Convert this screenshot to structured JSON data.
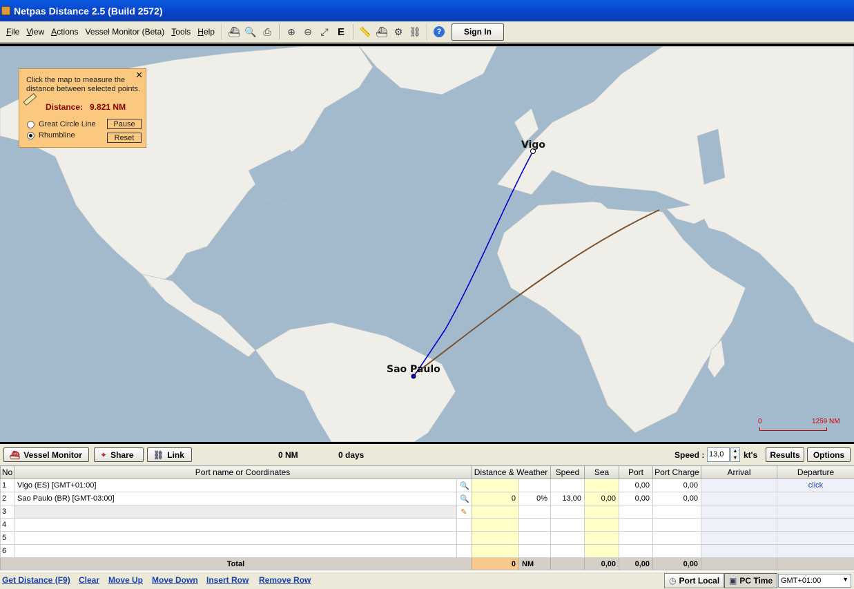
{
  "window": {
    "title": "Netpas Distance 2.5 (Build 2572)"
  },
  "menu": [
    {
      "first": "F",
      "rest": "ile"
    },
    {
      "first": "V",
      "rest": "iew"
    },
    {
      "first": "A",
      "rest": "ctions"
    },
    {
      "first": "",
      "rest": "Vessel Monitor (Beta)"
    },
    {
      "first": "T",
      "rest": "ools"
    },
    {
      "first": "H",
      "rest": "elp"
    }
  ],
  "toolbar": {
    "icons": [
      "ship-list-icon",
      "print-preview-icon",
      "print-icon",
      "zoom-in-icon",
      "zoom-out-icon",
      "fit-extent-icon",
      "eca-icon",
      "ruler-icon",
      "vessel-icon",
      "route-tools-icon",
      "link-chain-icon",
      "help-icon"
    ],
    "eca_glyph": "E",
    "sign_in_label": "Sign In"
  },
  "measure_panel": {
    "instructions": "Click the map to measure the distance between selected points.",
    "distance_label": "Distance:",
    "distance_value": "9.821 NM",
    "great_circle_label": "Great Circle Line",
    "rhumbline_label": "Rhumbline",
    "selected_mode": "rhumbline",
    "pause_label": "Pause",
    "reset_label": "Reset",
    "close_glyph": "✕"
  },
  "map": {
    "ports": [
      {
        "name": "Vigo"
      },
      {
        "name": "Sao Paulo"
      }
    ],
    "scale": {
      "start": "0",
      "end": "1259 NM"
    },
    "colors": {
      "sea": "#a3bacd",
      "land": "#efeee9",
      "route": "#0000cc",
      "measure_line": "#7a5230",
      "scale": "#cc0000"
    }
  },
  "actions": {
    "vessel_monitor_label": "Vessel Monitor",
    "share_label": "Share",
    "link_label": "Link",
    "total_distance": "0 NM",
    "total_days": "0 days",
    "speed_label": "Speed :",
    "speed_value": "13,0",
    "speed_unit": "kt's",
    "results_label": "Results",
    "options_label": "Options"
  },
  "grid": {
    "columns": [
      "No",
      "Port name or Coordinates",
      "Distance & Weather",
      "Speed",
      "Sea",
      "Port",
      "Port Charge",
      "Arrival",
      "Departure"
    ],
    "rows": [
      {
        "no": "1",
        "name": "Vigo (ES) [GMT+01:00]",
        "icon": "search-icon",
        "dist": "",
        "weather": "",
        "speed": "",
        "sea": "",
        "port": "0,00",
        "charge": "0,00",
        "arrival": "",
        "departure": "click"
      },
      {
        "no": "2",
        "name": "Sao Paulo (BR) [GMT-03:00]",
        "icon": "search-icon",
        "dist": "0",
        "weather": "0%",
        "speed": "13,00",
        "sea": "0,00",
        "port": "0,00",
        "charge": "0,00",
        "arrival": "",
        "departure": ""
      },
      {
        "no": "3",
        "name": "",
        "icon": "pencil-icon",
        "dist": "",
        "weather": "",
        "speed": "",
        "sea": "",
        "port": "",
        "charge": "",
        "arrival": "",
        "departure": ""
      },
      {
        "no": "4",
        "name": "",
        "icon": "",
        "dist": "",
        "weather": "",
        "speed": "",
        "sea": "",
        "port": "",
        "charge": "",
        "arrival": "",
        "departure": ""
      },
      {
        "no": "5",
        "name": "",
        "icon": "",
        "dist": "",
        "weather": "",
        "speed": "",
        "sea": "",
        "port": "",
        "charge": "",
        "arrival": "",
        "departure": ""
      },
      {
        "no": "6",
        "name": "",
        "icon": "",
        "dist": "",
        "weather": "",
        "speed": "",
        "sea": "",
        "port": "",
        "charge": "",
        "arrival": "",
        "departure": ""
      }
    ],
    "total": {
      "label": "Total",
      "dist": "0",
      "unit": "NM",
      "sea": "0,00",
      "port": "0,00",
      "charge": "0,00"
    }
  },
  "bottom": {
    "links": [
      "Get Distance (F9)",
      "Clear",
      "Move Up",
      "Move Down",
      "Insert Row",
      "Remove Row"
    ],
    "port_local_label": "Port Local",
    "pc_time_label": "PC Time",
    "timezone_value": "GMT+01:00"
  }
}
